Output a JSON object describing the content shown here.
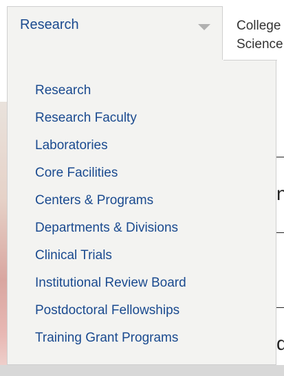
{
  "dropdown": {
    "selected_label": "Research",
    "caret_icon": "caret-down-icon",
    "items": [
      {
        "label": "Research"
      },
      {
        "label": "Research Faculty"
      },
      {
        "label": "Laboratories"
      },
      {
        "label": "Core Facilities"
      },
      {
        "label": "Centers & Programs"
      },
      {
        "label": "Departments & Divisions"
      },
      {
        "label": "Clinical Trials"
      },
      {
        "label": "Institutional Review Board"
      },
      {
        "label": "Postdoctoral Fellowships"
      },
      {
        "label": "Training Grant Programs"
      }
    ]
  },
  "background": {
    "college_line1": "College",
    "college_line2": "Science",
    "fragment_1": "n",
    "fragment_2": "d"
  },
  "colors": {
    "link_blue": "#1a4a8f",
    "panel_bg": "#f3f3f1"
  }
}
